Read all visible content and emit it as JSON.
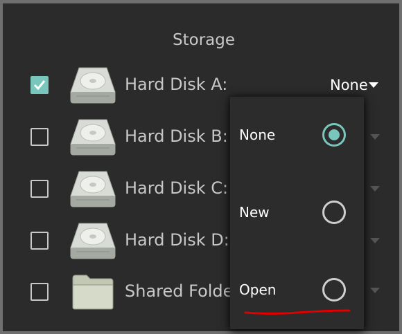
{
  "section": {
    "title": "Storage"
  },
  "rows": [
    {
      "label": "Hard Disk A:",
      "checked": true,
      "icon": "hard-disk-icon",
      "value": "None"
    },
    {
      "label": "Hard Disk B:",
      "checked": false,
      "icon": "hard-disk-icon"
    },
    {
      "label": "Hard Disk C:",
      "checked": false,
      "icon": "hard-disk-icon"
    },
    {
      "label": "Hard Disk D:",
      "checked": false,
      "icon": "hard-disk-icon"
    },
    {
      "label": "Shared Folde",
      "checked": false,
      "icon": "folder-icon"
    }
  ],
  "menu": {
    "options": [
      {
        "label": "None",
        "selected": true
      },
      {
        "label": "New",
        "selected": false
      },
      {
        "label": "Open",
        "selected": false
      }
    ]
  },
  "colors": {
    "background": "#2b2b2b",
    "accent": "#79c6bd",
    "text": "#c8c8c8",
    "annotation": "#e00000"
  }
}
